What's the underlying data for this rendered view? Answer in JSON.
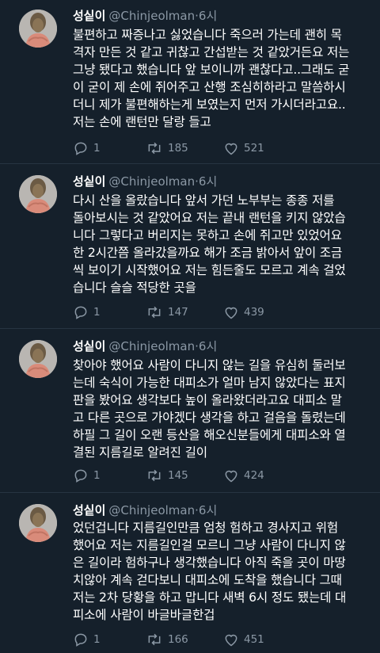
{
  "tweets": [
    {
      "name": "성싵이",
      "handle": "@Chinjeolman",
      "time_sep": "·",
      "time": "6시",
      "text": "불편하고 짜증나고 싫었습니다 죽으러 가는데 괜히 목\n격자 만든 것 같고 귀찮고 간섭받는 것 같았거든요 저는\n그냥 됐다고 했습니다 앞 보이니까 괜찮다고..그래도 굳\n이 굳이 제 손에 쥐어주고 산행 조심히하라고 말씀하시\n더니 제가 불편해하는게 보였는지 먼저 가시더라고요..\n저는 손에 랜턴만 달랑 들고",
      "reply_count": "1",
      "retweet_count": "185",
      "like_count": "521"
    },
    {
      "name": "성싵이",
      "handle": "@Chinjeolman",
      "time_sep": "·",
      "time": "6시",
      "text": "다시 산을 올랐습니다 앞서 가던 노부부는 종종 저를\n돌아보시는 것 같았어요 저는 끝내 랜턴을 키지 않았습\n니다 그렇다고 버리지는 못하고 손에 쥐고만 있었어요\n한 2시간쯤 올라갔을까요 해가 조금 밝아서 앞이 조금\n씩 보이기 시작했어요 저는 힘든줄도 모르고 계속 걸었\n습니다 슬슬 적당한 곳을",
      "reply_count": "1",
      "retweet_count": "147",
      "like_count": "439"
    },
    {
      "name": "성싵이",
      "handle": "@Chinjeolman",
      "time_sep": "·",
      "time": "6시",
      "text": "찾아야 했어요 사람이 다니지 않는 길을 유심히 둘러보\n는데 숙식이 가능한 대피소가 얼마 남지 않았다는 표지\n판을 봤어요 생각보다 높이 올라왔더라고요 대피소 말\n고 다른 곳으로 가야겠다 생각을 하고 걸음을 돌렸는데\n하필 그 길이 오랜 등산을 해오신분들에게 대피소와 열\n결된 지름길로 알려진 길이",
      "reply_count": "1",
      "retweet_count": "145",
      "like_count": "424"
    },
    {
      "name": "성싵이",
      "handle": "@Chinjeolman",
      "time_sep": "·",
      "time": "6시",
      "text": "었던겁니다 지름길인만큼 엄청 험하고 경사지고 위험\n했어요 저는 지름길인걸 모르니 그냥 사람이 다니지 않\n은 길이라 험하구나 생각했습니다 아직 죽을 곳이 마땅\n치않아 계속 걷다보니 대피소에 도착을 했습니다 그때\n저는 2차 당황을 하고 맙니다 새벽 6시 정도 됐는데 대\n피소에 사람이 바글바글한겁",
      "reply_count": "1",
      "retweet_count": "166",
      "like_count": "451"
    }
  ],
  "icons": {
    "reply": "reply-icon",
    "retweet": "retweet-icon",
    "like": "heart-icon",
    "avatar": "statue-avatar"
  },
  "colors": {
    "background": "#15202b",
    "muted": "#8b98a5",
    "text": "#ffffff"
  }
}
